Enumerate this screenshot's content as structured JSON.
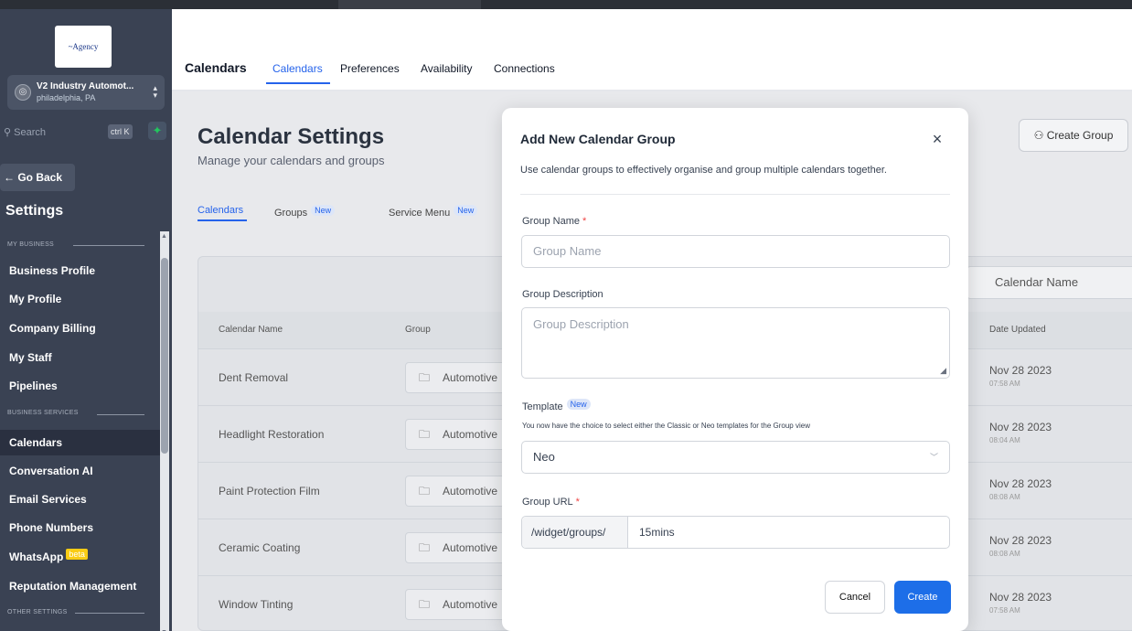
{
  "sidebar": {
    "logo_text": "~Agency",
    "account": {
      "name": "V2 Industry Automot...",
      "location": "philadelphia, PA"
    },
    "search": {
      "placeholder": "Search",
      "shortcut": "ctrl K"
    },
    "go_back": "← Go Back",
    "settings_heading": "Settings",
    "sections": [
      {
        "title": "MY BUSINESS"
      },
      {
        "title": "BUSINESS SERVICES"
      },
      {
        "title": "OTHER SETTINGS"
      }
    ],
    "items": [
      {
        "label": "Business Profile"
      },
      {
        "label": "My Profile"
      },
      {
        "label": "Company Billing"
      },
      {
        "label": "My Staff"
      },
      {
        "label": "Pipelines"
      },
      {
        "label": "Calendars"
      },
      {
        "label": "Conversation AI"
      },
      {
        "label": "Email Services"
      },
      {
        "label": "Phone Numbers"
      },
      {
        "label": "WhatsApp",
        "badge": "beta"
      },
      {
        "label": "Reputation Management"
      }
    ]
  },
  "topnav": {
    "title": "Calendars",
    "tabs": [
      {
        "label": "Calendars"
      },
      {
        "label": "Preferences"
      },
      {
        "label": "Availability"
      },
      {
        "label": "Connections"
      }
    ]
  },
  "page": {
    "title": "Calendar Settings",
    "subtitle": "Manage your calendars and groups",
    "create_group": "Create Group",
    "tabs": [
      {
        "label": "Calendars"
      },
      {
        "label": "Groups",
        "badge": "New"
      },
      {
        "label": "Service Menu",
        "badge": "New"
      }
    ],
    "search_placeholder": "Calendar Name",
    "columns": [
      "Calendar Name",
      "Group",
      "Date Updated"
    ],
    "rows": [
      {
        "name": "Dent Removal",
        "group": "Automotive",
        "date": "Nov 28 2023",
        "time": "07:58 AM"
      },
      {
        "name": "Headlight Restoration",
        "group": "Automotive",
        "date": "Nov 28 2023",
        "time": "08:04 AM"
      },
      {
        "name": "Paint Protection Film",
        "group": "Automotive",
        "date": "Nov 28 2023",
        "time": "08:08 AM"
      },
      {
        "name": "Ceramic Coating",
        "group": "Automotive",
        "date": "Nov 28 2023",
        "time": "08:08 AM"
      },
      {
        "name": "Window Tinting",
        "group": "Automotive",
        "date": "Nov 28 2023",
        "time": "07:58 AM"
      }
    ]
  },
  "modal": {
    "title": "Add New Calendar Group",
    "close": "×",
    "description": "Use calendar groups to effectively organise and group multiple calendars together.",
    "group_name_label": "Group Name",
    "group_name_placeholder": "Group Name",
    "group_description_label": "Group Description",
    "group_description_placeholder": "Group Description",
    "template_label": "Template",
    "template_badge": "New",
    "template_hint": "You now have the choice to select either the Classic or Neo templates for the Group view",
    "template_value": "Neo",
    "group_url_label": "Group URL",
    "url_prefix": "/widget/groups/",
    "url_value": "15mins",
    "required_mark": "*",
    "cancel": "Cancel",
    "create": "Create"
  },
  "colors": {
    "sidebar_bg": "#3a4253",
    "accent": "#2563eb",
    "primary_button": "#1d6ee8",
    "required": "#ef4444"
  }
}
